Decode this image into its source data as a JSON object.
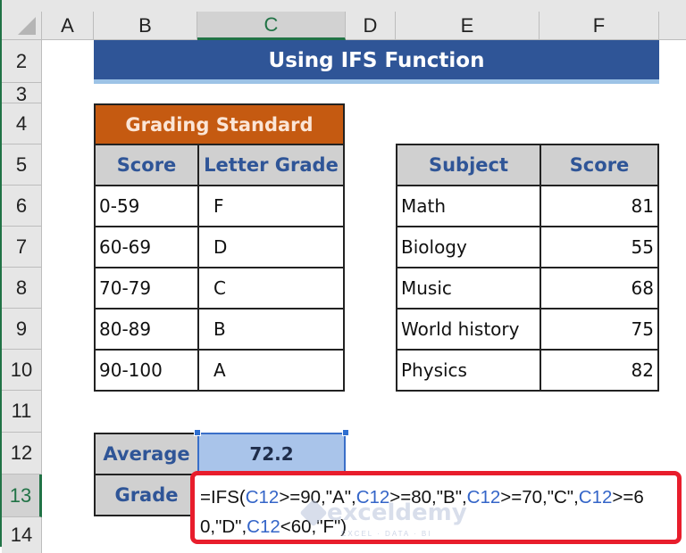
{
  "spreadsheet": {
    "column_headers": [
      "A",
      "B",
      "C",
      "D",
      "E",
      "F"
    ],
    "active_column": "C",
    "row_headers": [
      "2",
      "3",
      "4",
      "5",
      "6",
      "7",
      "8",
      "9",
      "10",
      "11",
      "12",
      "13",
      "14"
    ],
    "active_row": "13"
  },
  "title": "Using IFS Function",
  "grading_standard": {
    "title": "Grading Standard",
    "headers": [
      "Score",
      "Letter Grade"
    ],
    "rows": [
      {
        "score": "0-59",
        "grade": "F"
      },
      {
        "score": "60-69",
        "grade": "D"
      },
      {
        "score": "70-79",
        "grade": "C"
      },
      {
        "score": "80-89",
        "grade": "B"
      },
      {
        "score": "90-100",
        "grade": "A"
      }
    ]
  },
  "subject_scores": {
    "headers": [
      "Subject",
      "Score"
    ],
    "rows": [
      {
        "subject": "Math",
        "score": "81"
      },
      {
        "subject": "Biology",
        "score": "55"
      },
      {
        "subject": "Music",
        "score": "68"
      },
      {
        "subject": "World history",
        "score": "75"
      },
      {
        "subject": "Physics",
        "score": "82"
      }
    ]
  },
  "summary": {
    "average_label": "Average",
    "average_value": "72.2",
    "grade_label": "Grade"
  },
  "formula": {
    "parts": [
      {
        "t": "=IFS(",
        "ref": false
      },
      {
        "t": "C12",
        "ref": true
      },
      {
        "t": ">=90,\"A\",",
        "ref": false
      },
      {
        "t": "C12",
        "ref": true
      },
      {
        "t": ">=80,\"B\",",
        "ref": false
      },
      {
        "t": "C12",
        "ref": true
      },
      {
        "t": ">=70,\"C\",",
        "ref": false
      },
      {
        "t": "C12",
        "ref": true
      },
      {
        "t": ">=",
        "ref": false
      },
      {
        "t": "60,\"D\",",
        "ref": false
      },
      {
        "t": "C12",
        "ref": true
      },
      {
        "t": "<60,\"F\")",
        "ref": false
      }
    ]
  },
  "watermark": {
    "name": "exceldemy",
    "tagline": "EXCEL · DATA · BI"
  },
  "colors": {
    "title_bg": "#2f5597",
    "grading_title_bg": "#c55a11",
    "header_bg": "#d0d0d0",
    "header_text": "#2f5597",
    "selection": "#a9c4ea",
    "highlight_border": "#e81d2c",
    "ref_color": "#3465c8"
  }
}
